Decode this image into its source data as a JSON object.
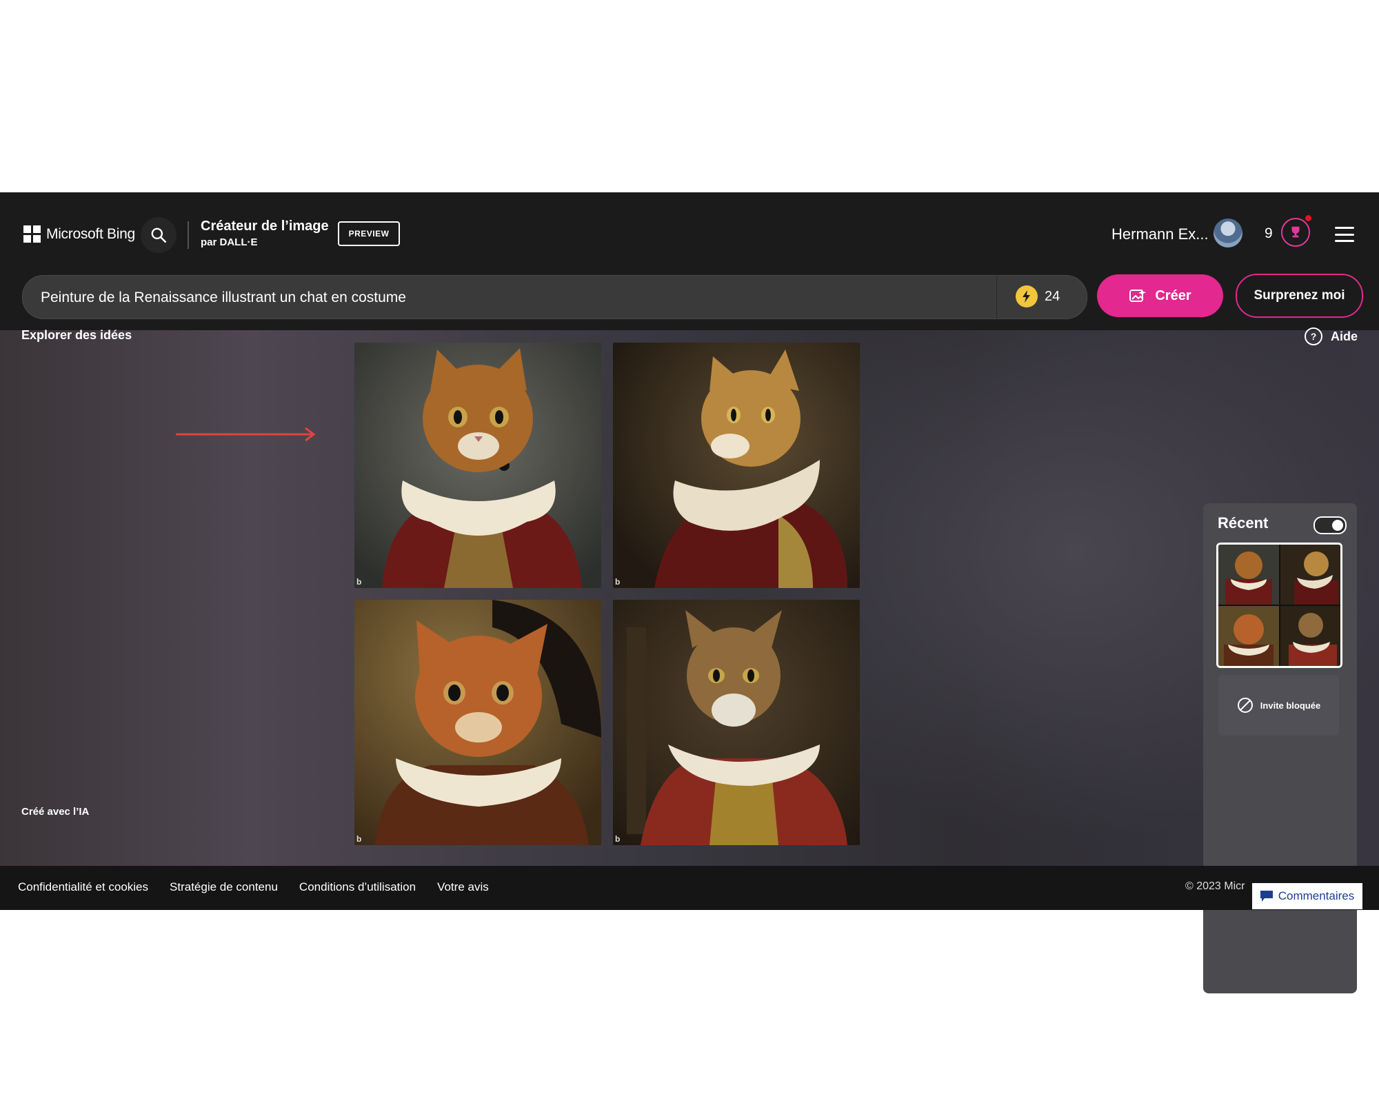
{
  "header": {
    "brand": "Microsoft Bing",
    "product_title": "Créateur de l’image",
    "product_sub": "par DALL·E",
    "badge": "PREVIEW",
    "user_name": "Hermann Ex...",
    "rewards_count": "9",
    "icons": [
      "microsoft-logo",
      "search-icon",
      "avatar",
      "rewards-icon",
      "hamburger-menu-icon"
    ]
  },
  "prompt": {
    "value": "Peinture de la Renaissance illustrant un chat en costume",
    "boosts": "24",
    "create_label": "Créer",
    "surprise_label": "Surprenez moi"
  },
  "main": {
    "explore_label": "Explorer des idées",
    "help_label": "Aide",
    "ai_label": "Créé avec l’IA",
    "images": [
      {
        "name": "cat-portrait-1",
        "collar": "#efe6d1",
        "robe": "#7a1c1a",
        "bg": "#5a5a52"
      },
      {
        "name": "cat-portrait-2",
        "collar": "#e9dfc8",
        "robe": "#6a1a17",
        "bg": "#3e3122"
      },
      {
        "name": "cat-portrait-3",
        "collar": "#efe6d1",
        "robe": "#7a2a18",
        "bg": "#5d4a26"
      },
      {
        "name": "cat-portrait-4",
        "collar": "#ece4d0",
        "robe": "#8a2a1f",
        "bg": "#3d2f20"
      }
    ]
  },
  "recent": {
    "title": "Récent",
    "blocked_label": "Invite bloquée"
  },
  "footer": {
    "links": [
      "Confidentialité et cookies",
      "Stratégie de contenu",
      "Conditions d’utilisation",
      "Votre avis"
    ],
    "copyright": "© 2023 Micr",
    "feedback_label": "Commentaires"
  },
  "colors": {
    "accent": "#e3288f",
    "header_bg": "#1b1b1b",
    "arrow": "#e0443e"
  }
}
